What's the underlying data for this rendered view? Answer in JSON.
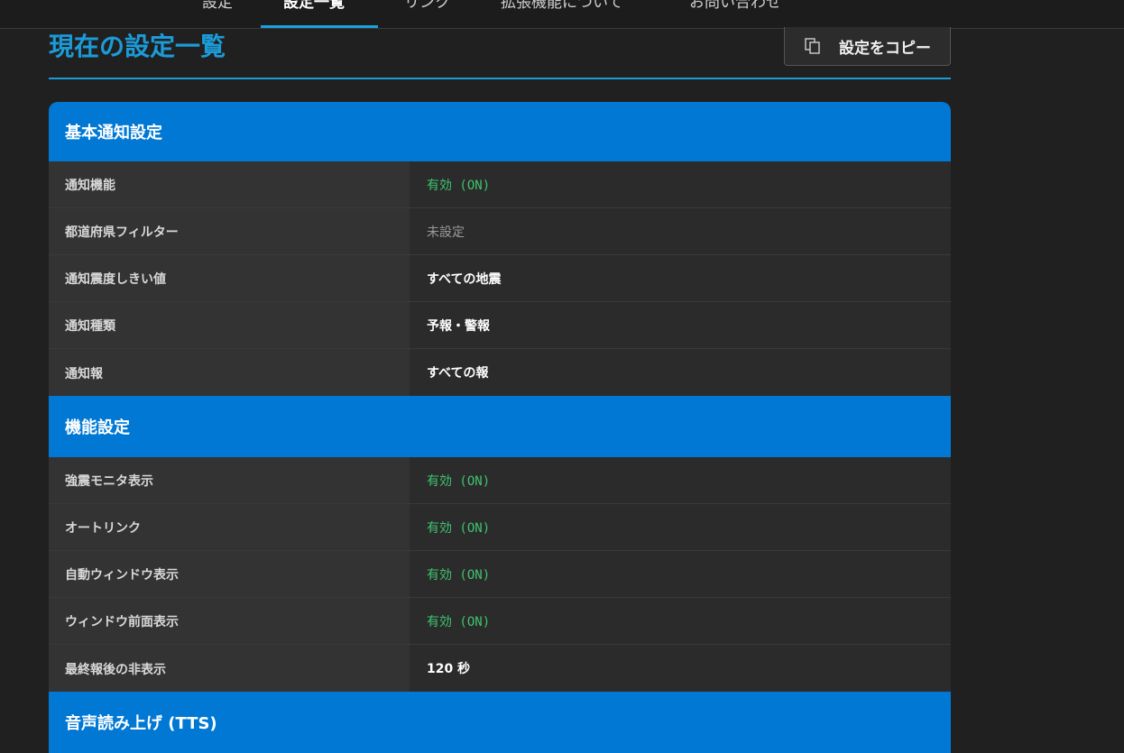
{
  "nav": {
    "tabs": [
      {
        "label": "設定"
      },
      {
        "label": "設定一覧"
      },
      {
        "label": "リンク"
      },
      {
        "label": "拡張機能について"
      },
      {
        "label": "お問い合わせ"
      }
    ]
  },
  "page": {
    "title": "現在の設定一覧",
    "copy_button": "設定をコピー"
  },
  "sections": [
    {
      "title": "基本通知設定",
      "rows": [
        {
          "label": "通知機能",
          "value": "有効 (ON)",
          "status": "on"
        },
        {
          "label": "都道府県フィルター",
          "value": "未設定",
          "status": "unset"
        },
        {
          "label": "通知震度しきい値",
          "value": "すべての地震",
          "status": "text"
        },
        {
          "label": "通知種類",
          "value": "予報・警報",
          "status": "text"
        },
        {
          "label": "通知報",
          "value": "すべての報",
          "status": "text"
        }
      ]
    },
    {
      "title": "機能設定",
      "rows": [
        {
          "label": "強震モニタ表示",
          "value": "有効 (ON)",
          "status": "on"
        },
        {
          "label": "オートリンク",
          "value": "有効 (ON)",
          "status": "on"
        },
        {
          "label": "自動ウィンドウ表示",
          "value": "有効 (ON)",
          "status": "on"
        },
        {
          "label": "ウィンドウ前面表示",
          "value": "有効 (ON)",
          "status": "on"
        },
        {
          "label": "最終報後の非表示",
          "value": "120 秒",
          "status": "text"
        }
      ]
    },
    {
      "title": "音声読み上げ (TTS)",
      "rows": []
    }
  ],
  "colors": {
    "accent": "#0078d4",
    "title": "#1b9bd8",
    "on": "#3ec46d",
    "unset": "#9a9a9a"
  }
}
